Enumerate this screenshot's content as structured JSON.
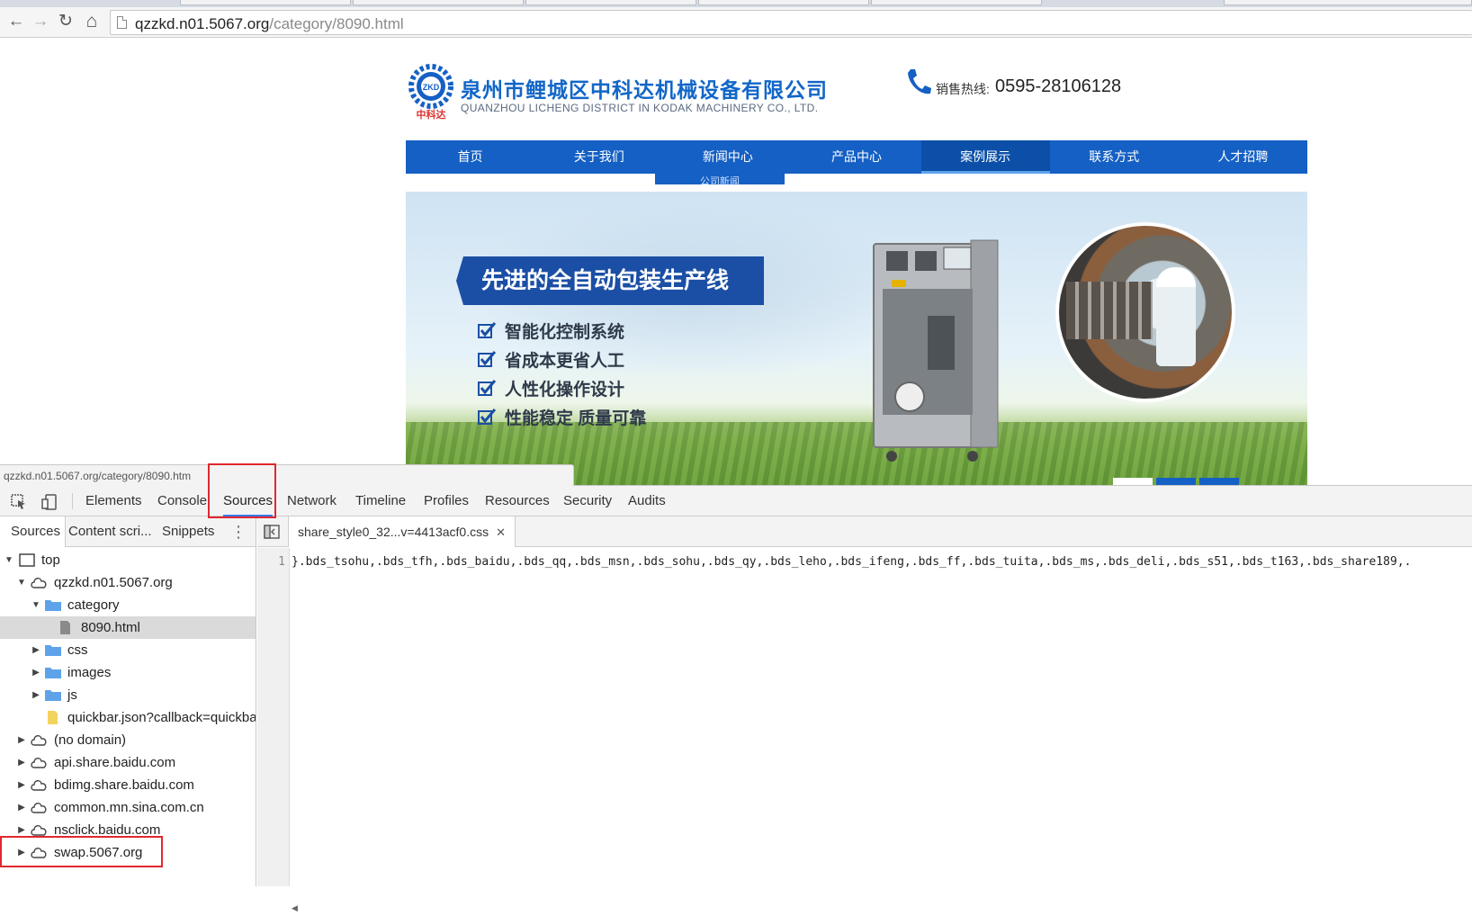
{
  "browser": {
    "url_host": "qzzkd.n01.5067.org",
    "url_path": "/category/8090.html",
    "back_glyph": "←",
    "forward_glyph": "→",
    "reload_glyph": "↻",
    "home_glyph": "⌂"
  },
  "site": {
    "company_name": "泉州市鲤城区中科达机械设备有限公司",
    "company_name_en": "QUANZHOU LICHENG DISTRICT IN KODAK MACHINERY CO., LTD.",
    "logo_text": "ZKD",
    "logo_caption": "中科达",
    "hotline_label": "销售热线:",
    "hotline_number": "0595-28106128",
    "nav": [
      "首页",
      "关于我们",
      "新闻中心",
      "产品中心",
      "案例展示",
      "联系方式",
      "人才招聘"
    ],
    "active_nav_index": 4,
    "submenu_item": "公司新闻",
    "banner": {
      "title": "先进的全自动包装生产线",
      "features": [
        "智能化控制系统",
        "省成本更省人工",
        "人性化操作设计",
        "性能稳定  质量可靠"
      ]
    }
  },
  "status_bar": "qzzkd.n01.5067.org/category/8090.htm",
  "devtools": {
    "tabs": [
      "Elements",
      "Console",
      "Sources",
      "Network",
      "Timeline",
      "Profiles",
      "Resources",
      "Security",
      "Audits"
    ],
    "active_tab": "Sources",
    "sidebar_tabs": [
      "Sources",
      "Content scri...",
      "Snippets"
    ],
    "tree": {
      "top": "top",
      "main_domain": "qzzkd.n01.5067.org",
      "category_folder": "category",
      "selected_file": "8090.html",
      "folders": [
        "css",
        "images",
        "js"
      ],
      "json_file": "quickbar.json?callback=quickba",
      "domains": [
        "(no domain)",
        "api.share.baidu.com",
        "bdimg.share.baidu.com",
        "common.mn.sina.com.cn",
        "nsclick.baidu.com",
        "swap.5067.org"
      ]
    },
    "open_file": "share_style0_32...v=4413acf0.css",
    "line_number": "1",
    "code_line": "}.bds_tsohu,.bds_tfh,.bds_baidu,.bds_qq,.bds_msn,.bds_sohu,.bds_qy,.bds_leho,.bds_ifeng,.bds_ff,.bds_tuita,.bds_ms,.bds_deli,.bds_s51,.bds_t163,.bds_share189,.",
    "highlighted": [
      "Sources",
      "swap.5067.org"
    ]
  },
  "colors": {
    "nav_blue": "#1560c4",
    "brand_blue": "#1166c8",
    "highlight_red": "#e0282e",
    "folder_blue": "#5ea3ea",
    "file_yellow": "#f2d35e"
  }
}
